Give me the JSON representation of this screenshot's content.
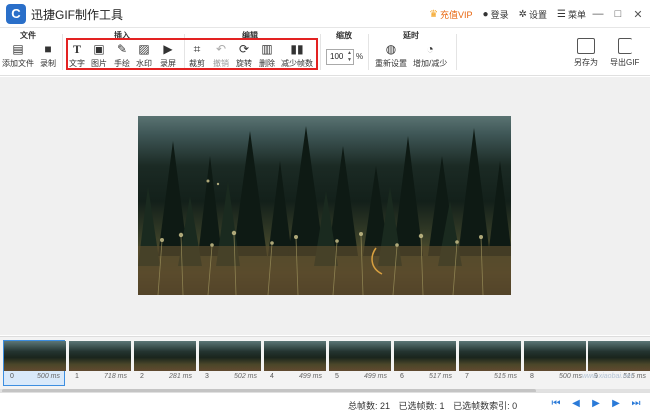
{
  "app": {
    "title": "迅捷GIF制作工具",
    "logo_letter": "C"
  },
  "titlebar": {
    "vip": "充值VIP",
    "login": "登录",
    "settings": "设置",
    "menu": "菜单",
    "minimize": "—",
    "maximize": "□",
    "close": "✕"
  },
  "toolbar": {
    "groups": {
      "file": "文件",
      "insert": "插入",
      "edit": "编辑",
      "scale": "缩放",
      "delay": "延时"
    },
    "file": {
      "add_file": "添加文件",
      "record": "录制"
    },
    "insert": {
      "text": "文字",
      "image": "图片",
      "draw": "手绘",
      "watermark": "水印",
      "screen_record": "录屏"
    },
    "edit": {
      "crop": "裁剪",
      "undo": "撤销",
      "rotate": "旋转",
      "delete": "删除",
      "reduce_frames": "减少帧数"
    },
    "scale": {
      "value": "100",
      "unit": "%"
    },
    "delay": {
      "reset": "重新设置",
      "increase_decrease": "增加/减少"
    },
    "save_as": "另存为",
    "export_gif": "导出GIF"
  },
  "filmstrip": {
    "frames": [
      {
        "index": "0",
        "ms": "500 ms"
      },
      {
        "index": "1",
        "ms": "718 ms"
      },
      {
        "index": "2",
        "ms": "281 ms"
      },
      {
        "index": "3",
        "ms": "502 ms"
      },
      {
        "index": "4",
        "ms": "499 ms"
      },
      {
        "index": "5",
        "ms": "499 ms"
      },
      {
        "index": "6",
        "ms": "517 ms"
      },
      {
        "index": "7",
        "ms": "515 ms"
      },
      {
        "index": "8",
        "ms": "500 ms"
      },
      {
        "index": "9",
        "ms": "515 ms"
      }
    ],
    "selected_index": 0
  },
  "status": {
    "total_frames": "总帧数: 21",
    "selected_frames": "已选帧数: 1",
    "selected_index": "已选帧数索引: 0"
  },
  "colors": {
    "accent": "#2a7ad8",
    "highlight_box": "#e32222",
    "vip": "#e8650e"
  },
  "watermark_text": "www.xiaobai.net"
}
